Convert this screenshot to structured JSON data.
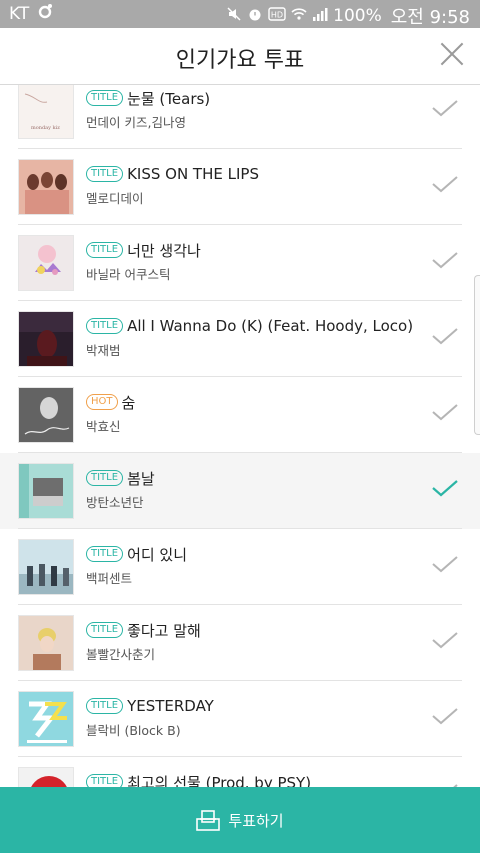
{
  "status_bar": {
    "carrier": "KT",
    "battery": "100%",
    "time": "오전 9:58",
    "icons": [
      "circle-logo-icon",
      "mute-icon",
      "alarm-icon",
      "hd-icon",
      "wifi-icon",
      "signal-icon"
    ]
  },
  "header": {
    "title": "인기가요 투표",
    "close_icon": "close-icon"
  },
  "songs": [
    {
      "badge": "TITLE",
      "title": "눈물 (Tears)",
      "artist": "먼데이 키즈,김나영",
      "selected": false
    },
    {
      "badge": "TITLE",
      "title": "KISS ON THE LIPS",
      "artist": "멜로디데이",
      "selected": false
    },
    {
      "badge": "TITLE",
      "title": "너만 생각나",
      "artist": "바닐라 어쿠스틱",
      "selected": false
    },
    {
      "badge": "TITLE",
      "title": "All I Wanna Do (K) (Feat. Hoody, Loco)",
      "artist": "박재범",
      "selected": false
    },
    {
      "badge": "HOT",
      "title": "숨",
      "artist": "박효신",
      "selected": false
    },
    {
      "badge": "TITLE",
      "title": "봄날",
      "artist": "방탄소년단",
      "selected": true
    },
    {
      "badge": "TITLE",
      "title": "어디 있니",
      "artist": "백퍼센트",
      "selected": false
    },
    {
      "badge": "TITLE",
      "title": "좋다고 말해",
      "artist": "볼빨간사춘기",
      "selected": false
    },
    {
      "badge": "TITLE",
      "title": "YESTERDAY",
      "artist": "블락비 (Block B)",
      "selected": false
    },
    {
      "badge": "TITLE",
      "title": "최고의 선물 (Prod. by PSY)",
      "artist": "",
      "selected": false
    }
  ],
  "vote_button": {
    "label": "투표하기",
    "icon": "ballot-box-icon"
  },
  "colors": {
    "accent": "#2bb5a5",
    "hot": "#f0a04b",
    "status_bar": "#a9a9a9"
  }
}
